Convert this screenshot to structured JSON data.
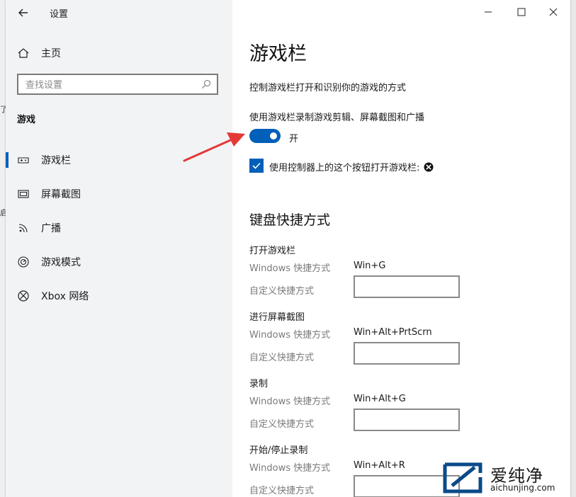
{
  "window": {
    "title": "设置"
  },
  "sidebar": {
    "home_label": "主页",
    "search_placeholder": "查找设置",
    "section_label": "游戏",
    "items": [
      {
        "label": "游戏栏",
        "icon": "game-bar-icon",
        "active": true
      },
      {
        "label": "屏幕截图",
        "icon": "capture-icon",
        "active": false
      },
      {
        "label": "广播",
        "icon": "broadcast-icon",
        "active": false
      },
      {
        "label": "游戏模式",
        "icon": "game-mode-icon",
        "active": false
      },
      {
        "label": "Xbox 网络",
        "icon": "xbox-icon",
        "active": false
      }
    ]
  },
  "main": {
    "title": "游戏栏",
    "description": "控制游戏栏打开和识别你的游戏的方式",
    "record_toggle": {
      "label": "使用游戏栏录制游戏剪辑、屏幕截图和广播",
      "state_label": "开",
      "on": true
    },
    "controller_checkbox": {
      "label": "使用控制器上的这个按钮打开游戏栏:",
      "checked": true,
      "icon": "xbox-icon"
    },
    "shortcuts_heading": "键盘快捷方式",
    "shortcut_groups": [
      {
        "title": "打开游戏栏",
        "windows_label": "Windows 快捷方式",
        "windows_value": "Win+G",
        "custom_label": "自定义快捷方式",
        "custom_value": ""
      },
      {
        "title": "进行屏幕截图",
        "windows_label": "Windows 快捷方式",
        "windows_value": "Win+Alt+PrtScrn",
        "custom_label": "自定义快捷方式",
        "custom_value": ""
      },
      {
        "title": "录制",
        "windows_label": "Windows 快捷方式",
        "windows_value": "Win+Alt+G",
        "custom_label": "自定义快捷方式",
        "custom_value": ""
      },
      {
        "title": "开始/停止录制",
        "windows_label": "Windows 快捷方式",
        "windows_value": "Win+Alt+R",
        "custom_label": "自定义快捷方式",
        "custom_value": ""
      }
    ]
  },
  "watermark": {
    "name": "爱纯净",
    "url": "aichunjing.com"
  },
  "colors": {
    "accent": "#005fb8",
    "arrow": "#e53935"
  }
}
